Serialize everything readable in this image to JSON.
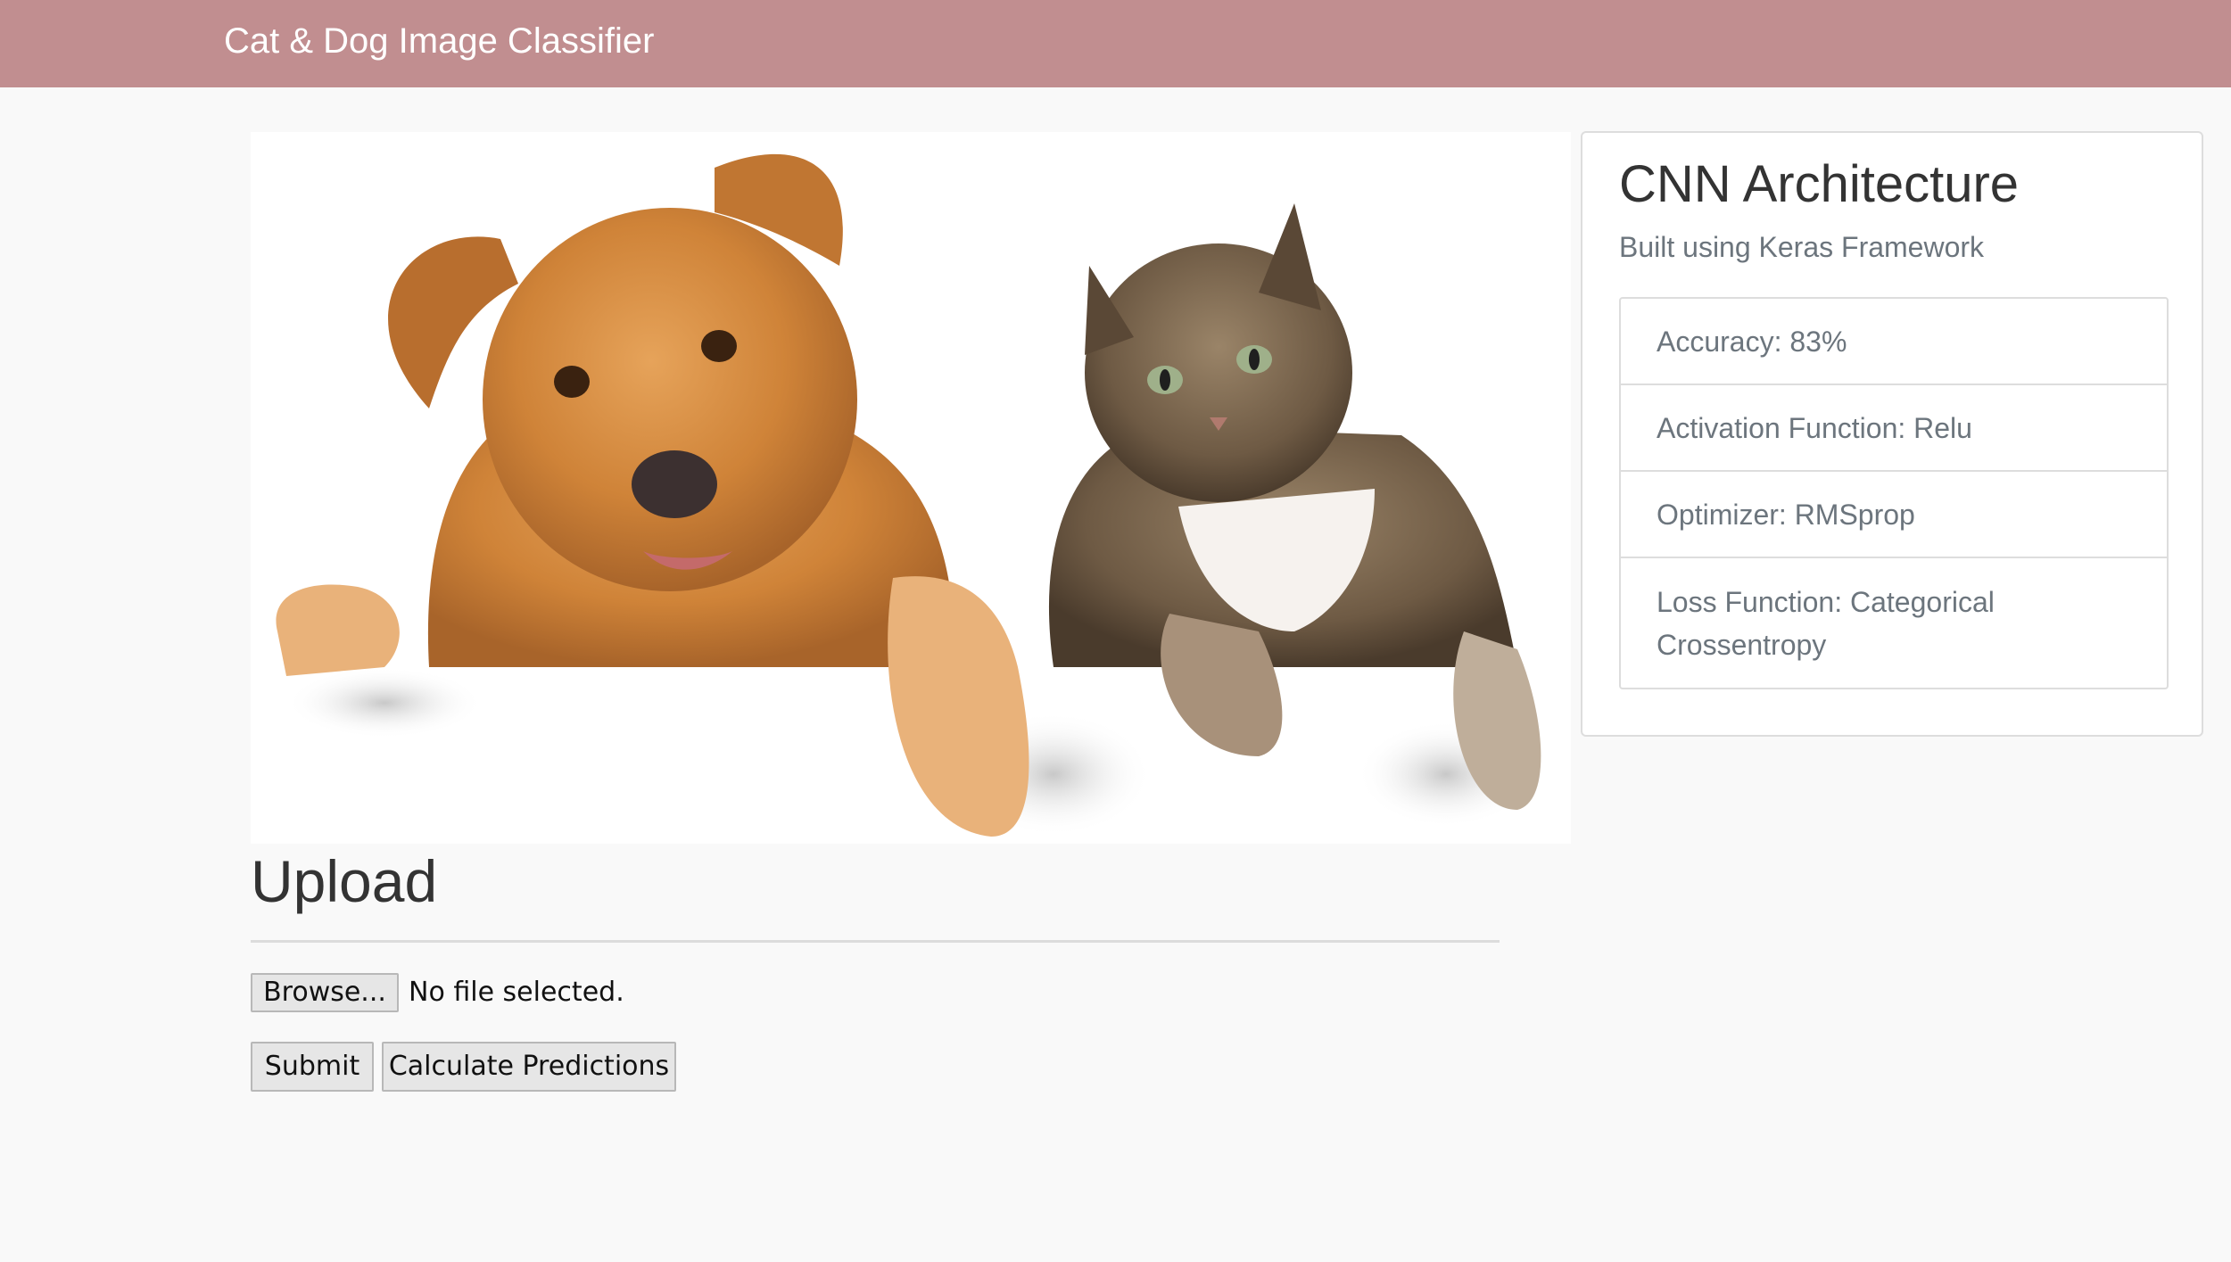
{
  "navbar": {
    "brand": "Cat & Dog Image Classifier",
    "background_color": "#c18e90"
  },
  "hero": {
    "image": "dog-and-cat-photo"
  },
  "upload": {
    "heading": "Upload",
    "browse_label": "Browse...",
    "file_status": "No file selected.",
    "submit_label": "Submit",
    "predict_label": "Calculate Predictions"
  },
  "panel": {
    "title": "CNN Architecture",
    "subtitle": "Built using Keras Framework",
    "items": [
      "Accuracy: 83%",
      "Activation Function: Relu",
      "Optimizer: RMSprop",
      "Loss Function: Categorical Crossentropy"
    ]
  }
}
